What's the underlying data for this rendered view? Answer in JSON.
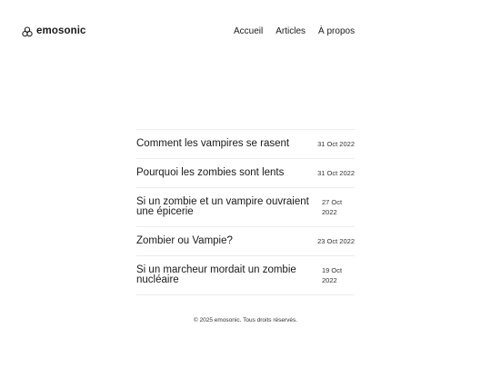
{
  "brand": {
    "name": "emosonic",
    "icon": "triple-circle-logo-icon"
  },
  "nav": {
    "items": [
      {
        "label": "Accueil"
      },
      {
        "label": "Articles"
      },
      {
        "label": "À propos"
      }
    ]
  },
  "posts": [
    {
      "title": "Comment les vampires se rasent",
      "date": "31 Oct 2022"
    },
    {
      "title": "Pourquoi les zombies sont lents",
      "date": "31 Oct 2022"
    },
    {
      "title": "Si un zombie et un vampire ouvraient une épicerie",
      "date": "27 Oct 2022"
    },
    {
      "title": "Zombier ou Vampie?",
      "date": "23 Oct 2022"
    },
    {
      "title": "Si un marcheur mordait un zombie nucléaire",
      "date": "19 Oct 2022"
    }
  ],
  "footer": {
    "copyright": "© 2025 emosonic. Tous droits réservés."
  }
}
